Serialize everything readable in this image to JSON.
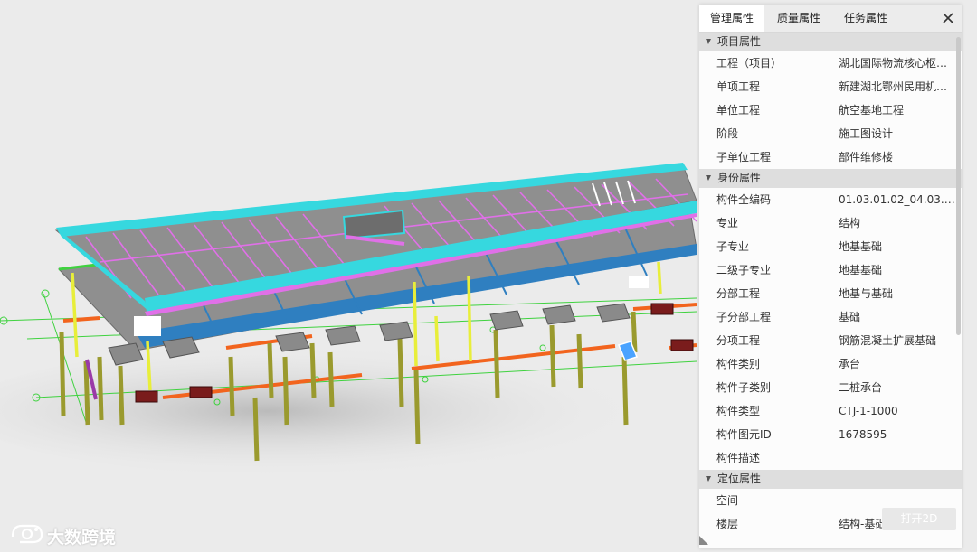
{
  "tabs": [
    {
      "label": "管理属性",
      "active": true
    },
    {
      "label": "质量属性",
      "active": false
    },
    {
      "label": "任务属性",
      "active": false
    }
  ],
  "icons": {
    "close": "close-icon",
    "collapse": "triangle-down-icon",
    "resize": "resize-corner-icon",
    "logo": "camera-logo-icon"
  },
  "sections": [
    {
      "title": "项目属性",
      "rows": [
        {
          "key": "工程（项目）",
          "value": "湖北国际物流核心枢纽项目"
        },
        {
          "key": "单项工程",
          "value": "新建湖北鄂州民用机场及转运中心"
        },
        {
          "key": "单位工程",
          "value": "航空基地工程"
        },
        {
          "key": "阶段",
          "value": "施工图设计"
        },
        {
          "key": "子单位工程",
          "value": "部件维修楼"
        }
      ]
    },
    {
      "title": "身份属性",
      "rows": [
        {
          "key": "构件全编码",
          "value": "01.03.01.02_04.03.01.0..."
        },
        {
          "key": "专业",
          "value": "结构"
        },
        {
          "key": "子专业",
          "value": "地基基础"
        },
        {
          "key": "二级子专业",
          "value": "地基基础"
        },
        {
          "key": "分部工程",
          "value": "地基与基础"
        },
        {
          "key": "子分部工程",
          "value": "基础"
        },
        {
          "key": "分项工程",
          "value": "钢筋混凝土扩展基础"
        },
        {
          "key": "构件类别",
          "value": "承台"
        },
        {
          "key": "构件子类别",
          "value": "二桩承台"
        },
        {
          "key": "构件类型",
          "value": "CTJ-1-1000"
        },
        {
          "key": "构件图元ID",
          "value": "1678595"
        },
        {
          "key": "构件描述",
          "value": ""
        }
      ]
    },
    {
      "title": "定位属性",
      "rows": [
        {
          "key": "空间",
          "value": ""
        },
        {
          "key": "楼层",
          "value": "结构-基础顶"
        }
      ]
    }
  ],
  "open2d_label": "打开2D",
  "watermark": "大数跨境",
  "colors": {
    "slab": "#8f8f8f",
    "edge": "#36d8df",
    "pink": "#e070e8",
    "blue": "#2f7fc0",
    "yellow": "#e8ee3a",
    "olive": "#9a9a2e",
    "orange": "#f2641e",
    "green": "#3fd23f",
    "dark": "#7a1c1c",
    "cap": "#8a8a8a"
  }
}
